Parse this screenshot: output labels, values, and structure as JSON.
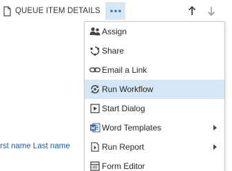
{
  "toolbar": {
    "queue_item_label": "QUEUE ITEM DETAILS",
    "more_label": "•••"
  },
  "background_link": "rst name Last name",
  "menu": {
    "items": [
      {
        "label": "Assign",
        "icon": "assign-users-icon",
        "submenu": false,
        "selected": false
      },
      {
        "label": "Share",
        "icon": "share-icon",
        "submenu": false,
        "selected": false
      },
      {
        "label": "Email a Link",
        "icon": "link-icon",
        "submenu": false,
        "selected": false
      },
      {
        "label": "Run Workflow",
        "icon": "workflow-icon",
        "submenu": false,
        "selected": true
      },
      {
        "label": "Start Dialog",
        "icon": "play-dialog-icon",
        "submenu": false,
        "selected": false
      },
      {
        "label": "Word Templates",
        "icon": "word-icon",
        "submenu": true,
        "selected": false
      },
      {
        "label": "Run Report",
        "icon": "report-icon",
        "submenu": true,
        "selected": false
      },
      {
        "label": "Form Editor",
        "icon": "form-editor-icon",
        "submenu": false,
        "selected": false
      }
    ]
  },
  "colors": {
    "accent_highlight": "#d5e6f4",
    "link": "#1160b7",
    "word_blue": "#2b579a"
  }
}
